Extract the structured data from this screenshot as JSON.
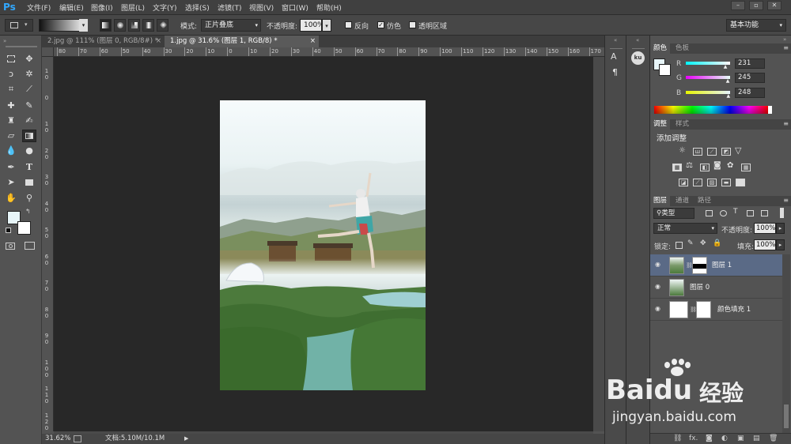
{
  "app": {
    "logo": "Ps"
  },
  "menu": [
    "文件(F)",
    "编辑(E)",
    "图像(I)",
    "图层(L)",
    "文字(Y)",
    "选择(S)",
    "滤镜(T)",
    "视图(V)",
    "窗口(W)",
    "帮助(H)"
  ],
  "window_buttons": [
    "–",
    "▫",
    "✕"
  ],
  "options": {
    "mode_label": "模式:",
    "mode_value": "正片叠底",
    "opacity_label": "不透明度:",
    "opacity_value": "100%",
    "reverse_label": "反向",
    "dither_label": "仿色",
    "transparency_label": "透明区域",
    "workspace": "基本功能"
  },
  "tabs": [
    {
      "label": "2.jpg @ 111% (图层 0, RGB/8#) *",
      "close": "×"
    },
    {
      "label": "1.jpg @ 31.6% (图层 1, RGB/8) *",
      "close": "×"
    }
  ],
  "ruler": {
    "top": [
      "80",
      "70",
      "60",
      "50",
      "40",
      "30",
      "20",
      "10",
      "0",
      "10",
      "20",
      "30",
      "40",
      "50",
      "60",
      "70",
      "80",
      "90",
      "100",
      "110",
      "120",
      "130",
      "140",
      "150",
      "160",
      "170"
    ],
    "left": [
      "1 0",
      "0",
      "1 0",
      "2 0",
      "3 0",
      "4 0",
      "5 0",
      "6 0",
      "7 0",
      "8 0",
      "9 0",
      "1 0 0",
      "1 1 0",
      "1 2 0"
    ]
  },
  "status": {
    "zoom": "31.62%",
    "doc": "文档:5.10M/10.1M"
  },
  "dock": {
    "char_icon": "A",
    "para_icon": "¶",
    "badge": "ku"
  },
  "color_panel": {
    "tabs": [
      "颜色",
      "色板"
    ],
    "labels": [
      "R",
      "G",
      "B"
    ],
    "values": [
      "231",
      "245",
      "248"
    ],
    "r": 231,
    "g": 245,
    "b": 248,
    "fg_color": "#e7f5f8"
  },
  "adjust_panel": {
    "tabs": [
      "调整",
      "样式"
    ],
    "title": "添加调整"
  },
  "layers_panel": {
    "tabs": [
      "图层",
      "通道",
      "路径"
    ],
    "filter": "类型",
    "blend": "正常",
    "opacity_label": "不透明度:",
    "opacity": "100%",
    "lock_label": "锁定:",
    "fill_label": "填充:",
    "fill": "100%",
    "layers": [
      {
        "name": "图层 1",
        "selected": true
      },
      {
        "name": "图层 0",
        "selected": false
      },
      {
        "name": "颜色填充 1",
        "selected": false
      }
    ],
    "footer_icons": [
      "⛓",
      "fx.",
      "◙",
      "◐",
      "▣",
      "▤",
      "🗑"
    ]
  },
  "watermark": {
    "brand": "Baidu",
    "cn": "经验",
    "url": "jingyan.baidu.com"
  },
  "colors": {
    "accent": "#31a8ff",
    "selected_layer": "#5a6a86"
  }
}
